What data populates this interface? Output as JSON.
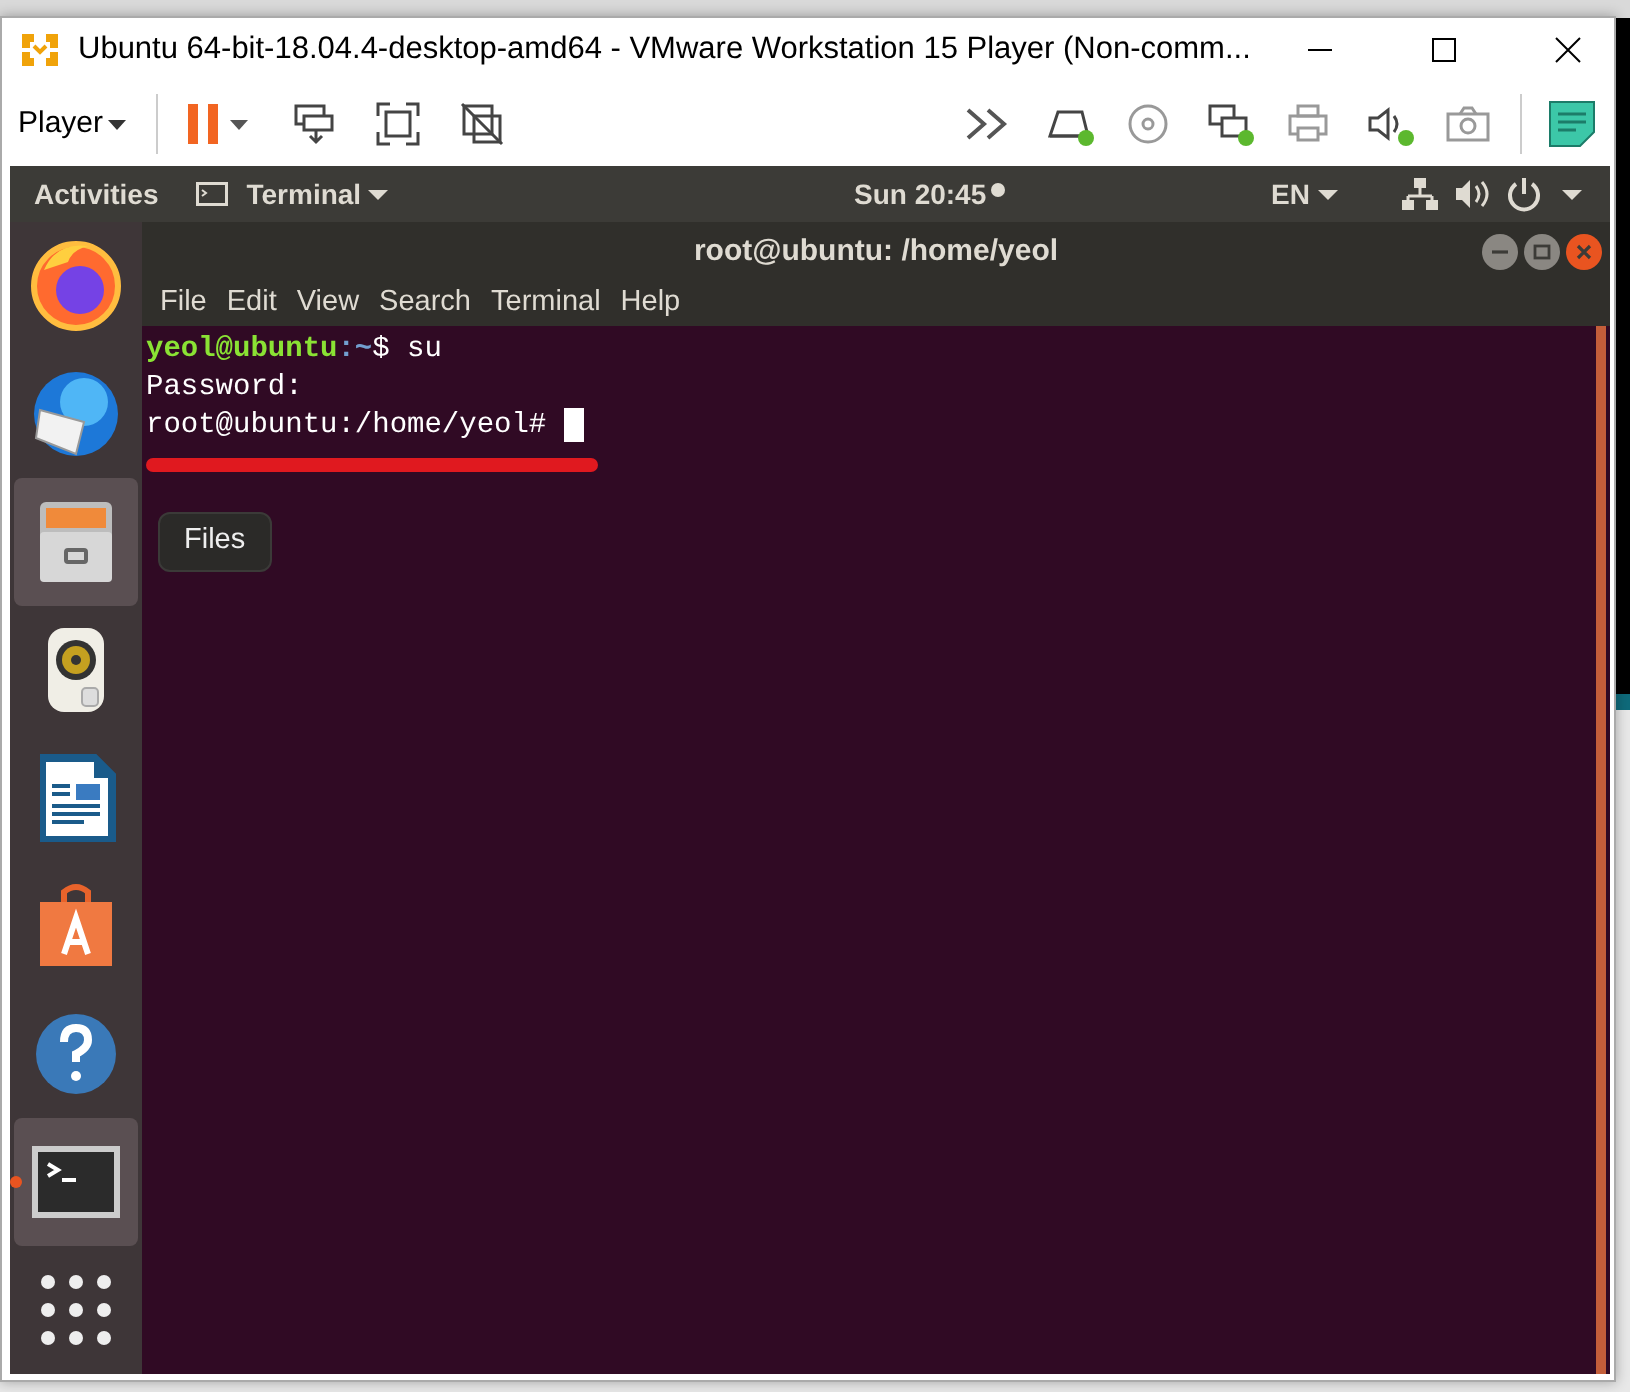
{
  "window": {
    "title": "Ubuntu 64-bit-18.04.4-desktop-amd64 - VMware Workstation 15 Player (Non-comm..."
  },
  "toolbar": {
    "player_menu": "Player",
    "paused": false,
    "left_tools": [
      {
        "kind": "send-keys"
      },
      {
        "kind": "fullscreen"
      },
      {
        "kind": "unity"
      }
    ],
    "devices": [
      {
        "kind": "more",
        "connected": false
      },
      {
        "kind": "disk",
        "connected": true
      },
      {
        "kind": "cd",
        "connected": false
      },
      {
        "kind": "network",
        "connected": true
      },
      {
        "kind": "printer",
        "connected": false
      },
      {
        "kind": "sound",
        "connected": true
      },
      {
        "kind": "camera",
        "connected": false
      }
    ]
  },
  "top_bar": {
    "activities": "Activities",
    "app_menu": "Terminal",
    "clock": "Sun 20:45",
    "language": "EN"
  },
  "dock": {
    "items": [
      {
        "kind": "firefox",
        "hovered": false,
        "running": false
      },
      {
        "kind": "mail",
        "hovered": false,
        "running": false
      },
      {
        "kind": "files",
        "hovered": true,
        "running": false
      },
      {
        "kind": "music",
        "hovered": false,
        "running": false
      },
      {
        "kind": "writer",
        "hovered": false,
        "running": false
      },
      {
        "kind": "store",
        "hovered": false,
        "running": false
      },
      {
        "kind": "help",
        "hovered": false,
        "running": false
      },
      {
        "kind": "terminal",
        "hovered": false,
        "running": true
      },
      {
        "kind": "apps",
        "hovered": false,
        "running": false
      }
    ],
    "tooltip": "Files"
  },
  "terminal": {
    "title": "root@ubuntu: /home/yeol",
    "menu": [
      "File",
      "Edit",
      "View",
      "Search",
      "Terminal",
      "Help"
    ],
    "lines": [
      {
        "kind": "prompt",
        "user": "yeol@ubuntu",
        "path": ":~",
        "text": "$ su"
      },
      {
        "kind": "output",
        "text": "Password:"
      },
      {
        "kind": "output",
        "text": "root@ubuntu:/home/yeol# ",
        "cursor": true
      }
    ]
  }
}
